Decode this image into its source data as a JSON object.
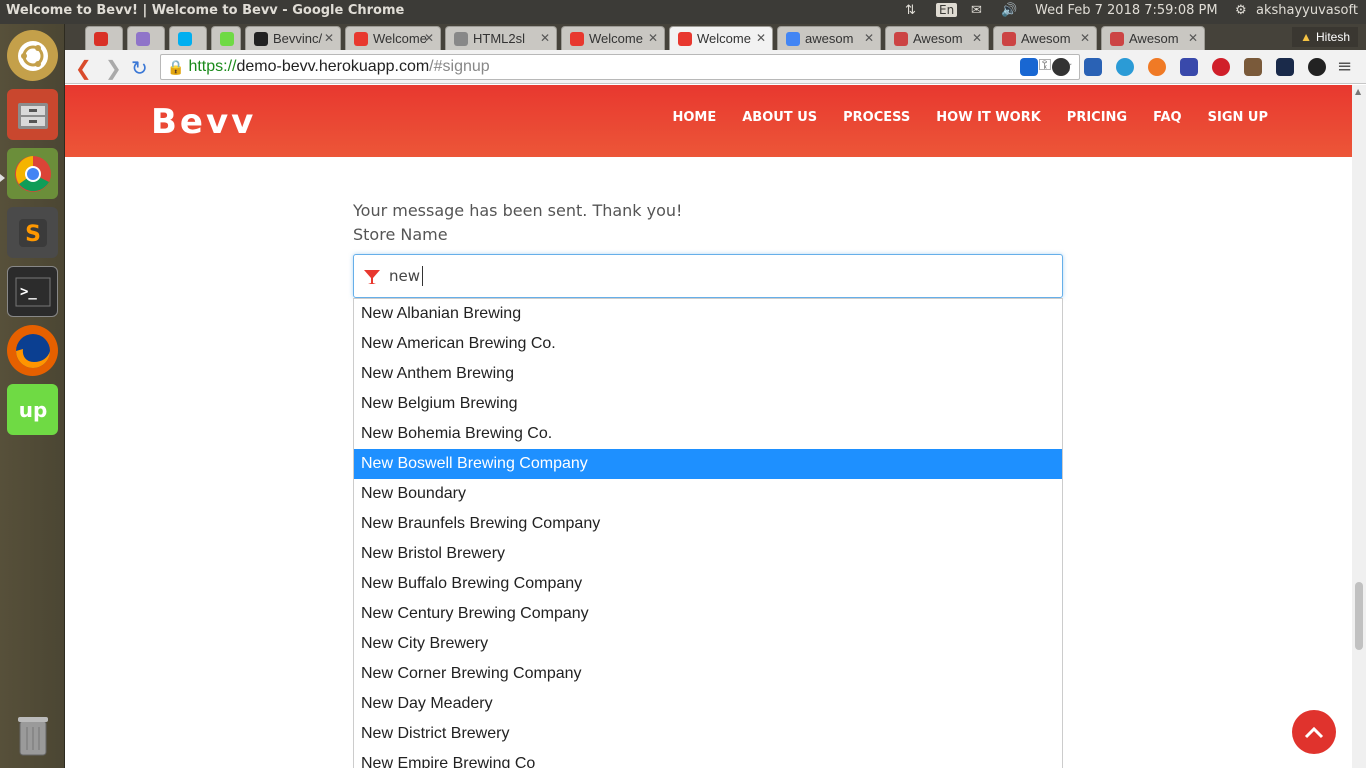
{
  "os": {
    "window_title": "Welcome to Bevv! | Welcome to Bevv - Google Chrome",
    "keyboard": "En",
    "datetime": "Wed Feb  7 2018  7:59:08 PM",
    "user": "akshayyuvasoft"
  },
  "launcher": {
    "items": [
      {
        "name": "ubuntu-dash-icon",
        "color": "#e95420"
      },
      {
        "name": "files-icon",
        "color": "#c9472e"
      },
      {
        "name": "chrome-icon",
        "color": "#3c8b3c"
      },
      {
        "name": "sublime-text-icon",
        "color": "#4a4a4a"
      },
      {
        "name": "terminal-icon",
        "color": "#2b2b2b"
      },
      {
        "name": "firefox-icon",
        "color": "#e66000"
      },
      {
        "name": "upwork-icon",
        "color": "#6fda44"
      }
    ],
    "trash": "trash-icon"
  },
  "browser": {
    "tabs": [
      {
        "label": "",
        "icon": "gmail-icon",
        "color": "#d93025"
      },
      {
        "label": "",
        "icon": "h-icon",
        "color": "#8f74c9"
      },
      {
        "label": "",
        "icon": "skype-icon",
        "color": "#00aff0"
      },
      {
        "label": "",
        "icon": "upwork-tab-icon",
        "color": "#6fda44"
      },
      {
        "label": "Bevvinc/",
        "icon": "github-icon",
        "color": "#222"
      },
      {
        "label": "Welcome",
        "icon": "bevv-icon",
        "color": "#e8382f"
      },
      {
        "label": "HTML2sl",
        "icon": "doc-icon",
        "color": "#888"
      },
      {
        "label": "Welcome",
        "icon": "bevv-icon",
        "color": "#e8382f"
      },
      {
        "label": "Welcome",
        "icon": "bevv-icon",
        "color": "#e8382f"
      },
      {
        "label": "awesom",
        "icon": "google-icon",
        "color": "#4285f4"
      },
      {
        "label": "Awesom",
        "icon": "awesome-icon",
        "color": "#c44"
      },
      {
        "label": "Awesom",
        "icon": "awesome-icon",
        "color": "#c44"
      },
      {
        "label": "Awesom",
        "icon": "awesome-icon",
        "color": "#c44"
      }
    ],
    "active_tab": 8,
    "profile": "Hitesh",
    "url_scheme": "https://",
    "url_host": "demo-bevv.herokuapp.com",
    "url_path": "/#signup"
  },
  "site": {
    "logo": "Bevv",
    "nav": [
      "HOME",
      "ABOUT US",
      "PROCESS",
      "HOW IT WORK",
      "PRICING",
      "FAQ",
      "SIGN UP"
    ],
    "accent": "#e8382f"
  },
  "form": {
    "message": "Your message has been sent. Thank you!",
    "store_label": "Store Name",
    "store_value": "new",
    "suggestions": [
      "New Albanian Brewing",
      "New American Brewing Co.",
      "New Anthem Brewing",
      "New Belgium Brewing",
      "New Bohemia Brewing Co.",
      "New Boswell Brewing Company",
      "New Boundary",
      "New Braunfels Brewing Company",
      "New Bristol Brewery",
      "New Buffalo Brewing Company",
      "New Century Brewing Company",
      "New City Brewery",
      "New Corner Brewing Company",
      "New Day Meadery",
      "New District Brewery",
      "New Empire Brewing Co"
    ],
    "selected_index": 5
  }
}
